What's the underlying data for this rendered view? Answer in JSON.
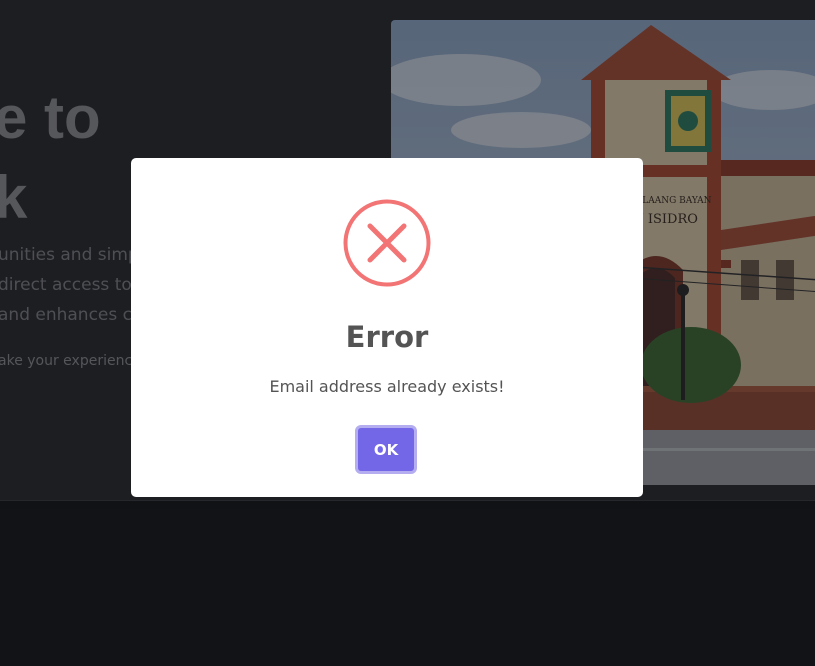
{
  "hero": {
    "title_line1": "e to",
    "title_line2": "k",
    "description_line1": "unities and simp",
    "description_line2": "direct access to c",
    "description_line3": "and enhances c",
    "subtext": "ake your experience"
  },
  "photo": {
    "sign_line1": "PAMAHALAANG BAYAN",
    "sign_line2": "SAN ISIDRO"
  },
  "dialog": {
    "icon": "error-x-icon",
    "title": "Error",
    "message": "Email address already exists!",
    "ok_label": "OK"
  },
  "colors": {
    "background": "#16171b",
    "dialog_background": "#ffffff",
    "error_red": "#f27474",
    "button_purple": "#7367e8",
    "button_focus_ring": "#b4adf0",
    "dialog_text": "#545454"
  }
}
